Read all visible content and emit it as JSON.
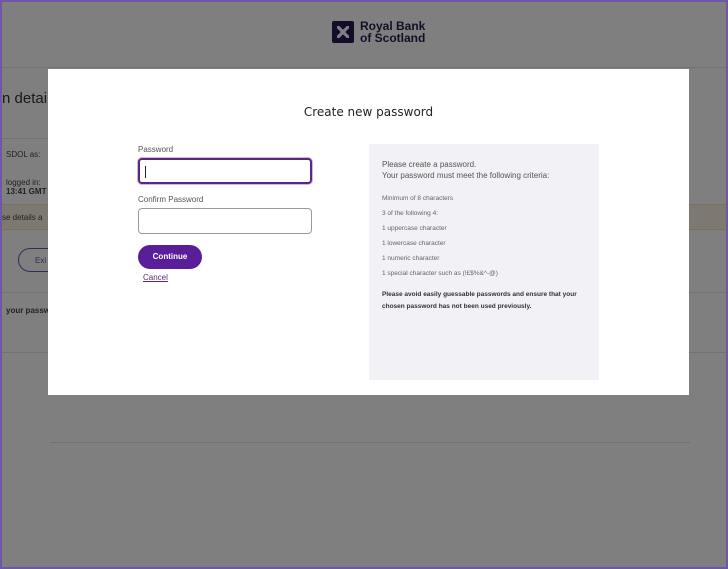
{
  "brand": {
    "logo_line1": "Royal Bank",
    "logo_line2": "of Scotland"
  },
  "background_page": {
    "title_fragment": "n detail",
    "label_sdol": "SDOL as:",
    "label_logged_in": "logged in:",
    "label_time": "13:41 GMT",
    "banner_fragment": "se details a",
    "exit_fragment": "Exi",
    "password_fragment": "your passw"
  },
  "modal": {
    "title": "Create new password",
    "password_label": "Password",
    "password_value": "",
    "confirm_label": "Confirm Password",
    "confirm_value": "",
    "continue_label": "Continue",
    "cancel_label": "Cancel"
  },
  "criteria": {
    "intro_line1": "Please create a password.",
    "intro_line2": "Your password must meet the following criteria:",
    "items": [
      "Minimum of 8 characters",
      "3 of the following 4:",
      "1 uppercase character",
      "1 lowercase character",
      "1 numeric character",
      "1 special character such as (!£$%&^-@)"
    ],
    "warning": "Please avoid easily guessable passwords and ensure that your chosen password has not been used previously."
  },
  "colors": {
    "brand_purple": "#5a287d",
    "button_purple": "#5a1e9a",
    "criteria_bg": "#f1f1f6"
  }
}
